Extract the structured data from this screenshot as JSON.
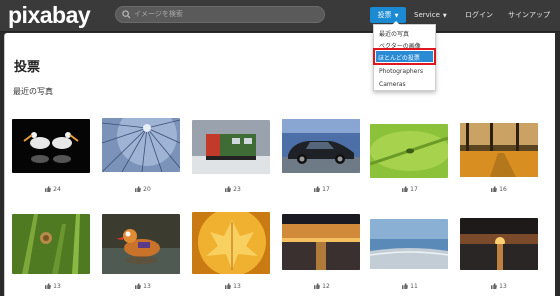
{
  "header": {
    "logo_text": "pixabay",
    "search_placeholder": "イメージを検索",
    "nav": {
      "vote_label": "投票",
      "service_label": "Service",
      "login_label": "ログイン",
      "signup_label": "サインアップ"
    }
  },
  "dropdown": {
    "items": [
      "最近の写真",
      "ベクターの画像",
      "ほとんどの投票",
      "Photographers",
      "Cameras"
    ],
    "selected_index": 2
  },
  "page": {
    "title": "投票",
    "section_title": "最近の写真"
  },
  "photos": [
    {
      "subject": "pelicans",
      "likes": "24"
    },
    {
      "subject": "dome-architecture",
      "likes": "20"
    },
    {
      "subject": "locomotive",
      "likes": "23"
    },
    {
      "subject": "car",
      "likes": "17"
    },
    {
      "subject": "insect-on-leaf",
      "likes": "17"
    },
    {
      "subject": "autumn-path",
      "likes": "16"
    },
    {
      "subject": "snail-on-grass",
      "likes": "13"
    },
    {
      "subject": "mandarin-duck",
      "likes": "13"
    },
    {
      "subject": "autumn-leaf",
      "likes": "13"
    },
    {
      "subject": "sunset-lake",
      "likes": "12"
    },
    {
      "subject": "beach",
      "likes": "11"
    },
    {
      "subject": "sunset-sea",
      "likes": "13"
    }
  ],
  "colors": {
    "accent": "#1b8ad3",
    "topbar": "#3a3a3a",
    "highlight_border": "#e0161e"
  },
  "icons": {
    "like": "thumbs-up-icon",
    "search": "search-icon",
    "caret": "caret-down-icon"
  }
}
